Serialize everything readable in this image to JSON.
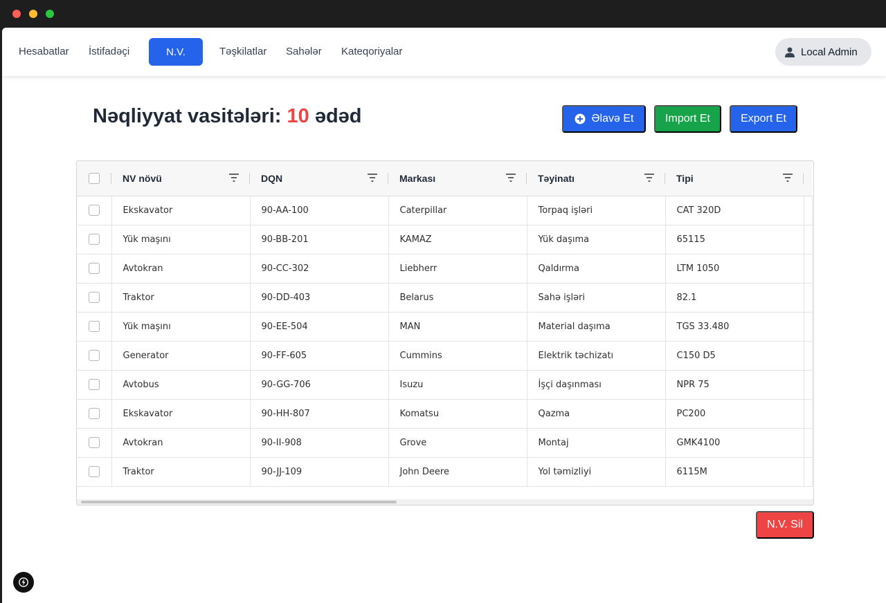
{
  "nav": {
    "links": [
      "Hesabatlar",
      "İstifadəçi",
      "N.V.",
      "Təşkilatlar",
      "Sahələr",
      "Kateqoriyalar"
    ],
    "user_label": "Local Admin"
  },
  "header": {
    "title_prefix": "Nəqliyyat vasitələri:",
    "count": "10",
    "title_suffix": "ədəd"
  },
  "actions": {
    "add_label": "Əlavə Et",
    "import_label": "Import Et",
    "export_label": "Export Et",
    "delete_label": "N.V. Sil"
  },
  "table": {
    "columns": [
      "NV növü",
      "DQN",
      "Markası",
      "Təyinatı",
      "Tipi"
    ],
    "rows": [
      [
        "Ekskavator",
        "90-AA-100",
        "Caterpillar",
        "Torpaq işləri",
        "CAT 320D"
      ],
      [
        "Yük maşını",
        "90-BB-201",
        "KAMAZ",
        "Yük daşıma",
        "65115"
      ],
      [
        "Avtokran",
        "90-CC-302",
        "Liebherr",
        "Qaldırma",
        "LTM 1050"
      ],
      [
        "Traktor",
        "90-DD-403",
        "Belarus",
        "Sahə işləri",
        "82.1"
      ],
      [
        "Yük maşını",
        "90-EE-504",
        "MAN",
        "Material daşıma",
        "TGS 33.480"
      ],
      [
        "Generator",
        "90-FF-605",
        "Cummins",
        "Elektrik təchizatı",
        "C150 D5"
      ],
      [
        "Avtobus",
        "90-GG-706",
        "Isuzu",
        "İşçi daşınması",
        "NPR 75"
      ],
      [
        "Ekskavator",
        "90-HH-807",
        "Komatsu",
        "Qazma",
        "PC200"
      ],
      [
        "Avtokran",
        "90-II-908",
        "Grove",
        "Montaj",
        "GMK4100"
      ],
      [
        "Traktor",
        "90-JJ-109",
        "John Deere",
        "Yol təmizliyi",
        "6115M"
      ]
    ]
  },
  "colors": {
    "primary": "#2563eb",
    "success": "#16a34a",
    "danger": "#ef4444"
  },
  "icons": {
    "add": "plus-circle-icon",
    "user": "user-icon",
    "filter": "filter-icon",
    "badge": "lightning-icon"
  }
}
